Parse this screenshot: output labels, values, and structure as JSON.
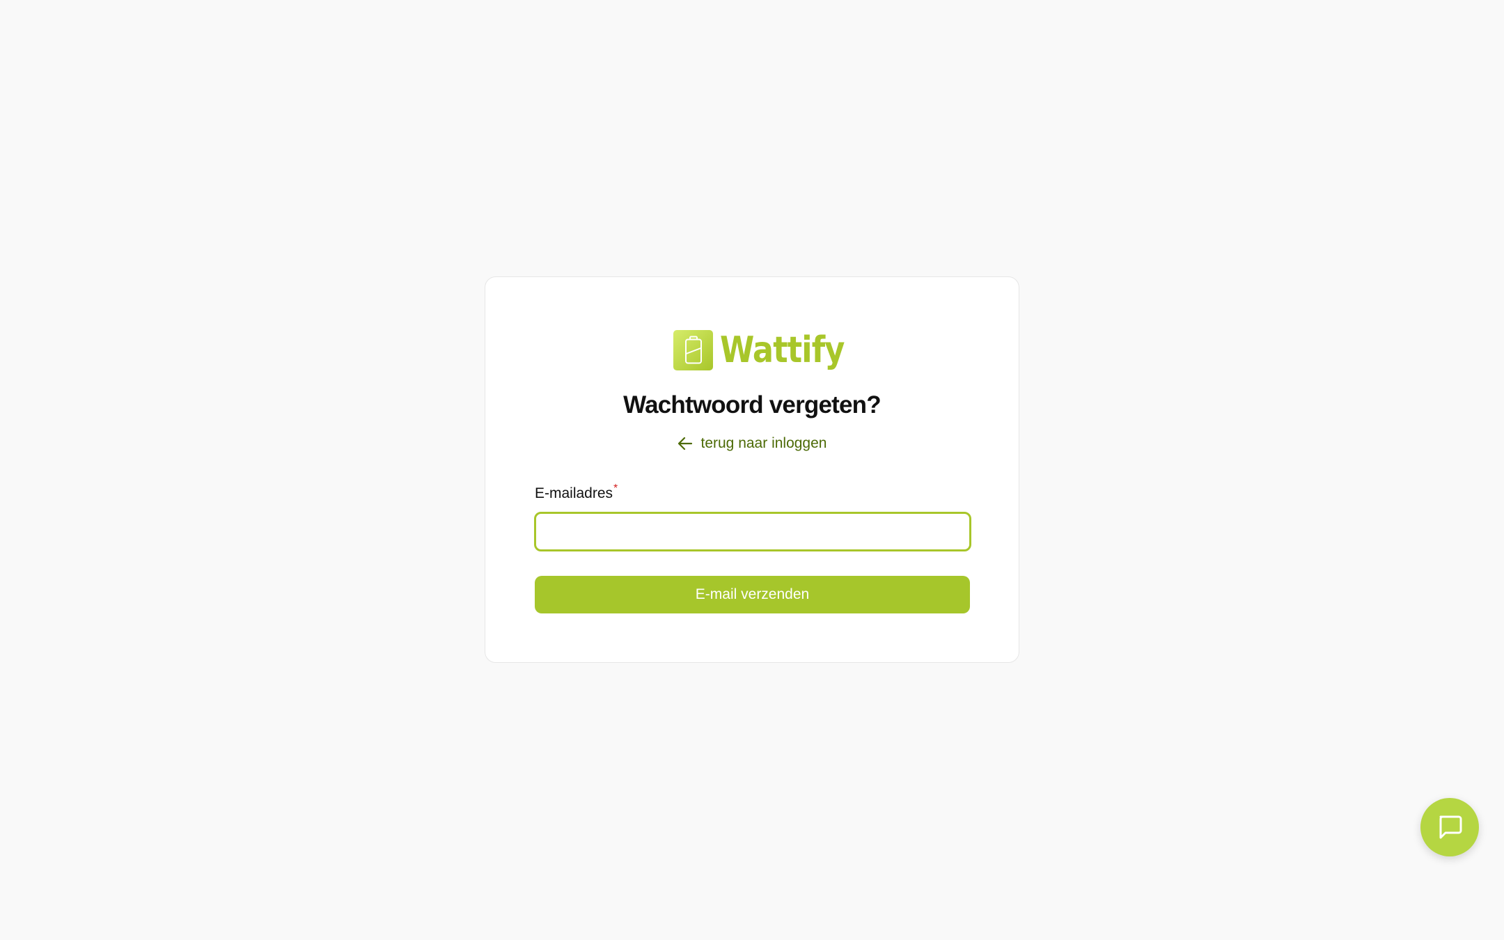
{
  "brand": {
    "name": "Wattify",
    "logo_icon": "battery-icon",
    "accent_color": "#a8c62a"
  },
  "form": {
    "title": "Wachtwoord vergeten?",
    "back_link": {
      "icon": "arrow-left-icon",
      "label": "terug naar inloggen"
    },
    "email": {
      "label": "E-mailadres",
      "required_marker": "*",
      "value": "",
      "placeholder": ""
    },
    "submit_label": "E-mail verzenden"
  },
  "chat": {
    "icon": "chat-bubble-icon"
  }
}
